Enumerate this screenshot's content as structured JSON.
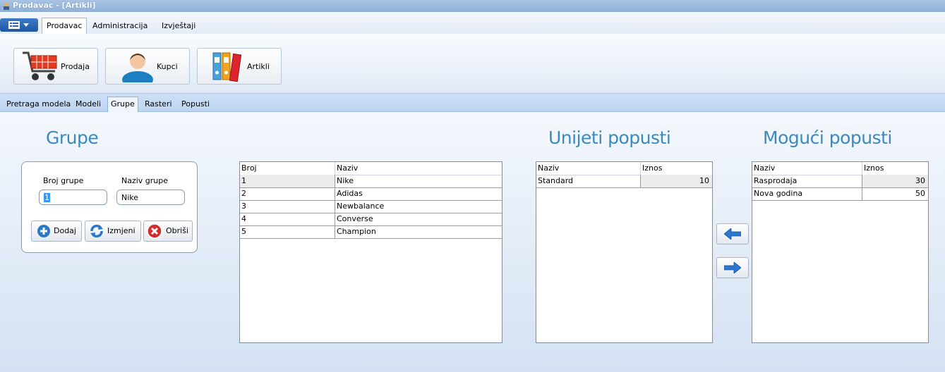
{
  "window": {
    "title": "Prodavac - [Artikli]"
  },
  "menu": {
    "tabs": [
      "Prodavac",
      "Administracija",
      "Izvještaji"
    ]
  },
  "ribbon": {
    "buttons": [
      "Prodaja",
      "Kupci",
      "Artikli"
    ]
  },
  "subtabs": [
    "Pretraga modela",
    "Modeli",
    "Grupe",
    "Rasteri",
    "Popusti"
  ],
  "grupe": {
    "heading": "Grupe",
    "broj_label": "Broj grupe",
    "naziv_label": "Naziv grupe",
    "broj_value": "1",
    "naziv_value": "Nike",
    "buttons": {
      "add": "Dodaj",
      "edit": "Izmjeni",
      "delete": "Obriši"
    }
  },
  "groups_table": {
    "columns": [
      "Broj",
      "Naziv"
    ],
    "rows": [
      [
        "1",
        "Nike"
      ],
      [
        "2",
        "Adidas"
      ],
      [
        "3",
        "Newbalance"
      ],
      [
        "4",
        "Converse"
      ],
      [
        "5",
        "Champion"
      ]
    ]
  },
  "entered_discounts": {
    "heading": "Unijeti popusti",
    "columns": [
      "Naziv",
      "Iznos"
    ],
    "rows": [
      [
        "Standard",
        "10"
      ]
    ]
  },
  "possible_discounts": {
    "heading": "Mogući popusti",
    "columns": [
      "Naziv",
      "Iznos"
    ],
    "rows": [
      [
        "Rasprodaja",
        "30"
      ],
      [
        "Nova godina",
        "50"
      ]
    ]
  }
}
